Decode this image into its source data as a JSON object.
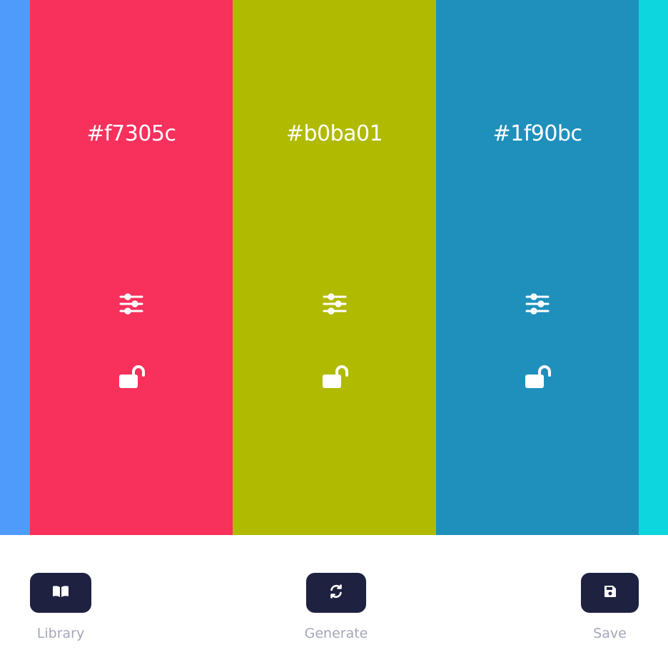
{
  "palette": {
    "left_edge_color": "#4f9bfb",
    "right_edge_color": "#0dd6de",
    "swatches": [
      {
        "hex": "#f7305c",
        "adjust_icon": "sliders-icon",
        "lock_icon": "unlock-icon",
        "locked": false
      },
      {
        "hex": "#b0ba01",
        "adjust_icon": "sliders-icon",
        "lock_icon": "unlock-icon",
        "locked": false
      },
      {
        "hex": "#1f90bc",
        "adjust_icon": "sliders-icon",
        "lock_icon": "unlock-icon",
        "locked": false
      }
    ]
  },
  "toolbar": {
    "button_color": "#1e2140",
    "label_color": "#a3a6b8",
    "library": {
      "label": "Library",
      "icon": "book-open-icon"
    },
    "generate": {
      "label": "Generate",
      "icon": "refresh-icon"
    },
    "save": {
      "label": "Save",
      "icon": "floppy-disk-icon"
    }
  }
}
